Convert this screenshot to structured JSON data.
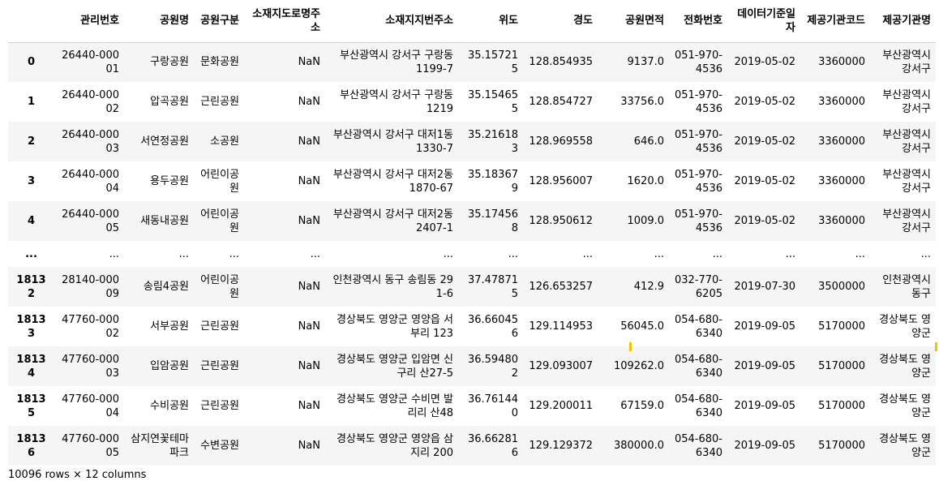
{
  "columns": [
    "관리번호",
    "공원명",
    "공원구분",
    "소재지도로명주소",
    "소재지지번주소",
    "위도",
    "경도",
    "공원면적",
    "전화번호",
    "데이터기준일자",
    "제공기관코드",
    "제공기관명"
  ],
  "rows": [
    {
      "index": "0",
      "cells": [
        "26440-00001",
        "구랑공원",
        "문화공원",
        "NaN",
        "부산광역시 강서구 구랑동 1199-7",
        "35.157215",
        "128.854935",
        "9137.0",
        "051-970-4536",
        "2019-05-02",
        "3360000",
        "부산광역시 강서구"
      ]
    },
    {
      "index": "1",
      "cells": [
        "26440-00002",
        "압곡공원",
        "근린공원",
        "NaN",
        "부산광역시 강서구 구랑동 1219",
        "35.154655",
        "128.854727",
        "33756.0",
        "051-970-4536",
        "2019-05-02",
        "3360000",
        "부산광역시 강서구"
      ]
    },
    {
      "index": "2",
      "cells": [
        "26440-00003",
        "서연정공원",
        "소공원",
        "NaN",
        "부산광역시 강서구 대저1동 1330-7",
        "35.216183",
        "128.969558",
        "646.0",
        "051-970-4536",
        "2019-05-02",
        "3360000",
        "부산광역시 강서구"
      ]
    },
    {
      "index": "3",
      "cells": [
        "26440-00004",
        "용두공원",
        "어린이공원",
        "NaN",
        "부산광역시 강서구 대저2동 1870-67",
        "35.183679",
        "128.956007",
        "1620.0",
        "051-970-4536",
        "2019-05-02",
        "3360000",
        "부산광역시 강서구"
      ]
    },
    {
      "index": "4",
      "cells": [
        "26440-00005",
        "새동내공원",
        "어린이공원",
        "NaN",
        "부산광역시 강서구 대저2동 2407-1",
        "35.174568",
        "128.950612",
        "1009.0",
        "051-970-4536",
        "2019-05-02",
        "3360000",
        "부산광역시 강서구"
      ]
    },
    {
      "index": "...",
      "cells": [
        "...",
        "...",
        "...",
        "...",
        "...",
        "...",
        "...",
        "...",
        "...",
        "...",
        "...",
        "..."
      ]
    },
    {
      "index": "18132",
      "cells": [
        "28140-00009",
        "송림4공원",
        "어린이공원",
        "NaN",
        "인천광역시 동구 송림동 291-6",
        "37.478715",
        "126.653257",
        "412.9",
        "032-770-6205",
        "2019-07-30",
        "3500000",
        "인천광역시 동구"
      ]
    },
    {
      "index": "18133",
      "cells": [
        "47760-00002",
        "서부공원",
        "근린공원",
        "NaN",
        "경상북도 영양군 영양읍 서부리 123",
        "36.660456",
        "129.114953",
        "56045.0",
        "054-680-6340",
        "2019-09-05",
        "5170000",
        "경상북도 영양군"
      ]
    },
    {
      "index": "18134",
      "cells": [
        "47760-00003",
        "입암공원",
        "근린공원",
        "NaN",
        "경상북도 영양군 입암면 신구리 산27-5",
        "36.594802",
        "129.093007",
        "109262.0",
        "054-680-6340",
        "2019-09-05",
        "5170000",
        "경상북도 영양군"
      ]
    },
    {
      "index": "18135",
      "cells": [
        "47760-00004",
        "수비공원",
        "근린공원",
        "NaN",
        "경상북도 영양군 수비면 발리리 산48",
        "36.761440",
        "129.200011",
        "67159.0",
        "054-680-6340",
        "2019-09-05",
        "5170000",
        "경상북도 영양군"
      ]
    },
    {
      "index": "18136",
      "cells": [
        "47760-00005",
        "삼지연꽃테마파크",
        "수변공원",
        "NaN",
        "경상북도 영양군 영양읍 삼지리 200",
        "36.662816",
        "129.129372",
        "380000.0",
        "054-680-6340",
        "2019-09-05",
        "5170000",
        "경상북도 영양군"
      ]
    }
  ],
  "footer": "10096 rows × 12 columns"
}
